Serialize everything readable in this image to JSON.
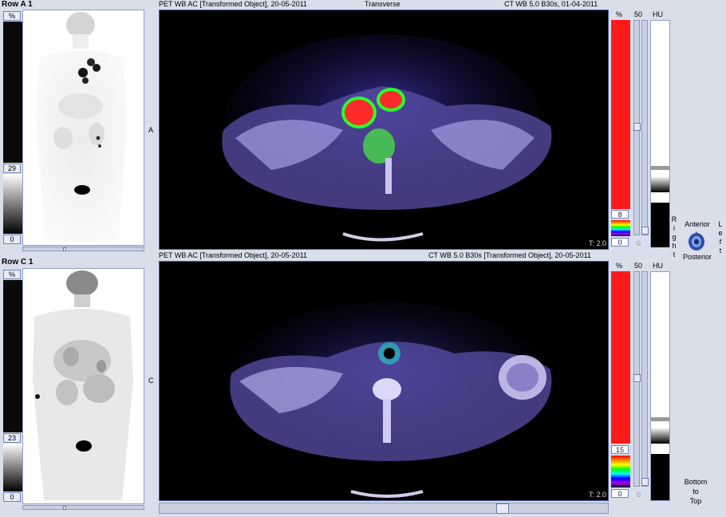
{
  "row_a": {
    "label": "Row A 1",
    "mip": {
      "pct_label": "%",
      "top_value": "0",
      "mid_value": "29",
      "bottom_value": "0",
      "side_marker": "A"
    },
    "header": {
      "left": "PET WB AC [Transformed Object], 20-05-2011",
      "center": "Transverse",
      "right": "CT WB  5.0  B30s, 01-04-2011"
    },
    "thickness": "T: 2.0",
    "pet_scale": {
      "pct_label": "%",
      "upper": "8",
      "lower": "0"
    },
    "ct_scale": {
      "top": "50",
      "bottom": "0"
    },
    "hu_label": "HU"
  },
  "row_c": {
    "label": "Row C 1",
    "mip": {
      "pct_label": "%",
      "top_value": "0",
      "mid_value": "23",
      "bottom_value": "0",
      "side_marker": "C"
    },
    "header": {
      "left": "PET WB AC [Transformed Object], 20-05-2011",
      "right": "CT WB  5.0  B30s [Transformed Object], 20-05-2011"
    },
    "thickness": "T: 2.0",
    "pet_scale": {
      "pct_label": "%",
      "upper": "15",
      "lower": "0"
    },
    "ct_scale": {
      "top": "50",
      "bottom": "0"
    },
    "hu_label": "HU"
  },
  "orientation": {
    "anterior": "Anterior",
    "posterior": "Posterior",
    "right_letters": [
      "R",
      "i",
      "g",
      "h",
      "t"
    ],
    "left_letters": [
      "L",
      "e",
      "f",
      "t"
    ],
    "bottom": "Bottom",
    "to": "to",
    "top": "Top"
  },
  "colors": {
    "pet_bar": "#ff1a1a",
    "panel_bg": "#d9deeb",
    "scan_bg": "#000000"
  }
}
